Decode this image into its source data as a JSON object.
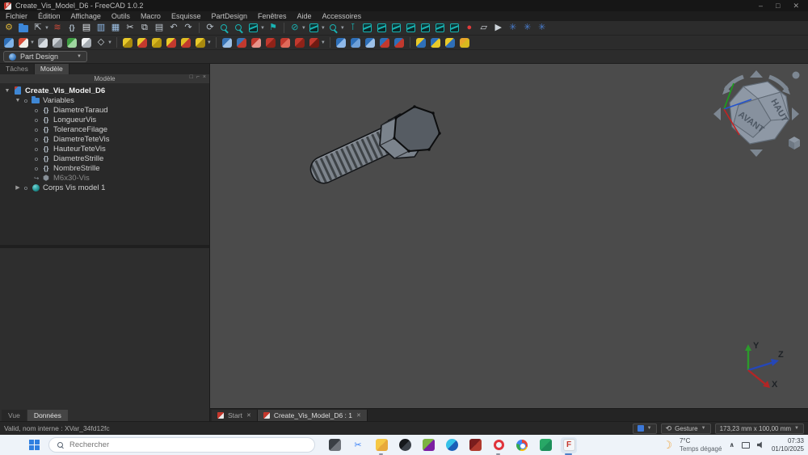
{
  "window": {
    "title": "Create_Vis_Model_D6 - FreeCAD 1.0.2",
    "minimize": "–",
    "maximize": "□",
    "close": "✕"
  },
  "menu": {
    "items": [
      "Fichier",
      "Édition",
      "Affichage",
      "Outils",
      "Macro",
      "Esquisse",
      "PartDesign",
      "Fenêtres",
      "Aide",
      "Accessoires"
    ]
  },
  "colors": {
    "accent_teal": "#19b3b3",
    "viewport_bg": "#4b4b4b",
    "taskbar_bg": "#eef3f9",
    "record_red": "#e23b3b"
  },
  "toolbar1": {
    "icons": [
      {
        "name": "freecad-start",
        "shape": "ch",
        "ch": "⚙",
        "c": "#d8b23a"
      },
      {
        "name": "open-folder",
        "shape": "fold",
        "c": "#3c86d8"
      },
      {
        "name": "export",
        "shape": "ch",
        "ch": "⇱",
        "c": "#c9d1d9",
        "dd": true
      },
      {
        "name": "appearance",
        "shape": "ch",
        "ch": "≋",
        "c": "#cf4a3a"
      },
      {
        "name": "expression",
        "shape": "ch",
        "ch": "{}",
        "c": "#aebecb",
        "small": true
      },
      {
        "name": "new-document",
        "shape": "ch",
        "ch": "▤",
        "c": "#e4e9ee"
      },
      {
        "name": "open-document",
        "shape": "ch",
        "ch": "▥",
        "c": "#8fb9e8"
      },
      {
        "name": "save",
        "shape": "ch",
        "ch": "▦",
        "c": "#9fc3e8"
      },
      {
        "name": "cut",
        "shape": "ch",
        "ch": "✂",
        "c": "#d2d9e0"
      },
      {
        "name": "copy",
        "shape": "ch",
        "ch": "⧉",
        "c": "#d2d9e0"
      },
      {
        "name": "paste",
        "shape": "ch",
        "ch": "▤",
        "c": "#bfc9d2"
      },
      {
        "name": "undo",
        "shape": "ch",
        "ch": "↶",
        "c": "#b6bfc8"
      },
      {
        "name": "redo",
        "shape": "ch",
        "ch": "↷",
        "c": "#b6bfc8"
      },
      {
        "sep": true
      },
      {
        "name": "refresh",
        "shape": "ch",
        "ch": "⟳",
        "c": "#b6bfc8"
      },
      {
        "name": "fit-all",
        "shape": "mag"
      },
      {
        "name": "fit-selection",
        "shape": "mag"
      },
      {
        "name": "view-isometric",
        "shape": "cube",
        "dd": true
      },
      {
        "name": "measure",
        "shape": "ch",
        "ch": "⚑",
        "c": "#19b3b3"
      },
      {
        "sep": true
      },
      {
        "name": "clipping",
        "shape": "ch",
        "ch": "⊘",
        "c": "#19b3b3",
        "dd": true
      },
      {
        "name": "axonometric",
        "shape": "cube",
        "dd": true
      },
      {
        "name": "zoom",
        "shape": "mag",
        "dd": true
      },
      {
        "name": "caliper",
        "shape": "ch",
        "ch": "⊺",
        "c": "#19b3b3"
      },
      {
        "name": "view-home",
        "shape": "cube"
      },
      {
        "name": "view-front",
        "shape": "cube"
      },
      {
        "name": "view-top",
        "shape": "cube"
      },
      {
        "name": "view-right",
        "shape": "cube"
      },
      {
        "name": "view-rear",
        "shape": "cube"
      },
      {
        "name": "view-bottom",
        "shape": "cube"
      },
      {
        "name": "view-left",
        "shape": "cube"
      },
      {
        "name": "macro-record",
        "shape": "ch",
        "ch": "●",
        "c": "#e23b3b"
      },
      {
        "name": "macro-edit",
        "shape": "ch",
        "ch": "▱",
        "c": "#d8dde2"
      },
      {
        "name": "macro-play",
        "shape": "ch",
        "ch": "▶",
        "c": "#cdd4da"
      },
      {
        "name": "debug-start",
        "shape": "ch",
        "ch": "✳",
        "c": "#4a7ed0"
      },
      {
        "name": "debug-stop",
        "shape": "ch",
        "ch": "✳",
        "c": "#4a7ed0"
      },
      {
        "name": "debug-step",
        "shape": "ch",
        "ch": "✳",
        "c": "#4a7ed0"
      }
    ]
  },
  "toolbar2": {
    "icons": [
      {
        "name": "create-body",
        "shape": "blob",
        "c1": "#2e6fb8",
        "c2": "#7fb2e8"
      },
      {
        "name": "create-sketch",
        "shape": "blob",
        "c1": "#d94f3a",
        "c2": "#f0efe8",
        "dd": true
      },
      {
        "name": "edit-sketch",
        "shape": "blob",
        "c1": "#8a9097",
        "c2": "#d7dce1"
      },
      {
        "name": "map-sketch",
        "shape": "blob",
        "c1": "#c9ced3",
        "c2": "#8d9399"
      },
      {
        "name": "clone",
        "shape": "blob",
        "c1": "#3f9d43",
        "c2": "#9fd6a0"
      },
      {
        "name": "shape-binder",
        "shape": "blob",
        "c1": "#eef0f2",
        "c2": "#a7adb3"
      },
      {
        "name": "datum",
        "shape": "ch",
        "ch": "◇",
        "c": "#ccd4db",
        "dd": true
      },
      {
        "sep": true
      },
      {
        "name": "pad",
        "shape": "blob",
        "c1": "#e8c92a",
        "c2": "#a8890e"
      },
      {
        "name": "revolution",
        "shape": "blob",
        "c1": "#e8c92a",
        "c2": "#c2392e"
      },
      {
        "name": "additive-loft",
        "shape": "blob",
        "c1": "#d8b81f",
        "c2": "#b5950f"
      },
      {
        "name": "additive-pipe",
        "shape": "blob",
        "c1": "#e8c92a",
        "c2": "#c2392e"
      },
      {
        "name": "additive-helix",
        "shape": "blob",
        "c1": "#e0bc22",
        "c2": "#c2392e"
      },
      {
        "name": "additive-primitive",
        "shape": "blob",
        "c1": "#e8c92a",
        "c2": "#a8890e",
        "dd": true
      },
      {
        "sep": true
      },
      {
        "name": "pocket",
        "shape": "blob",
        "c1": "#3a74b5",
        "c2": "#9dc1e8"
      },
      {
        "name": "hole",
        "shape": "blob",
        "c1": "#3a74b5",
        "c2": "#c2392e"
      },
      {
        "name": "groove",
        "shape": "blob",
        "c1": "#c2392e",
        "c2": "#e8938a"
      },
      {
        "name": "subtractive-loft",
        "shape": "blob",
        "c1": "#c2392e",
        "c2": "#8f2218"
      },
      {
        "name": "subtractive-pipe",
        "shape": "blob",
        "c1": "#c2392e",
        "c2": "#e06a5a"
      },
      {
        "name": "subtractive-helix",
        "shape": "blob",
        "c1": "#c2392e",
        "c2": "#8f2218"
      },
      {
        "name": "subtractive-primitive",
        "shape": "blob",
        "c1": "#c2392e",
        "c2": "#6f1a12",
        "dd": true
      },
      {
        "sep": true
      },
      {
        "name": "fillet",
        "shape": "blob",
        "c1": "#2e6fb8",
        "c2": "#8fb8e8"
      },
      {
        "name": "chamfer",
        "shape": "blob",
        "c1": "#2e6fb8",
        "c2": "#6fa0d8"
      },
      {
        "name": "draft",
        "shape": "blob",
        "c1": "#2e6fb8",
        "c2": "#9dc1e8"
      },
      {
        "name": "thickness",
        "shape": "blob",
        "c1": "#2e6fb8",
        "c2": "#c2392e"
      },
      {
        "name": "pattern",
        "shape": "blob",
        "c1": "#2e6fb8",
        "c2": "#c2392e"
      },
      {
        "sep": true
      },
      {
        "name": "boolean-union",
        "shape": "blob",
        "c1": "#e8c92a",
        "c2": "#2e6fb8"
      },
      {
        "name": "boolean-cut",
        "shape": "blob",
        "c1": "#2e6fb8",
        "c2": "#e8c92a"
      },
      {
        "name": "boolean-common",
        "shape": "blob",
        "c1": "#e8c92a",
        "c2": "#2e6fb8"
      },
      {
        "name": "boolean-compound",
        "shape": "blob",
        "c1": "#e8a52a",
        "c2": "#d8b81f"
      }
    ]
  },
  "workbench": {
    "selected": "Part Design"
  },
  "panel": {
    "tabs": [
      {
        "label": "Tâches",
        "active": false
      },
      {
        "label": "Modèle",
        "active": true
      }
    ],
    "header": "Modèle",
    "header_icons": [
      "float",
      "undock",
      "close"
    ]
  },
  "tree": {
    "items": [
      {
        "label": "Create_Vis_Model_D6",
        "lvl": 0,
        "arrow": "down",
        "icon": "doc",
        "bold": true
      },
      {
        "label": "Variables",
        "lvl": 1,
        "arrow": "down",
        "vis": true,
        "icon": "folder"
      },
      {
        "label": "DiametreTaraud",
        "lvl": 2,
        "vis": true,
        "icon": "var"
      },
      {
        "label": "LongueurVis",
        "lvl": 2,
        "vis": true,
        "icon": "var"
      },
      {
        "label": "ToleranceFilage",
        "lvl": 2,
        "vis": true,
        "icon": "var"
      },
      {
        "label": "DiametreTeteVis",
        "lvl": 2,
        "vis": true,
        "icon": "var"
      },
      {
        "label": "HauteurTeteVis",
        "lvl": 2,
        "vis": true,
        "icon": "var"
      },
      {
        "label": "DiametreStrille",
        "lvl": 2,
        "vis": true,
        "icon": "var"
      },
      {
        "label": "NombreStrille",
        "lvl": 2,
        "vis": true,
        "icon": "var"
      },
      {
        "label": "M6x30-Vis",
        "lvl": 2,
        "link": true,
        "icon": "screw",
        "gray": true
      },
      {
        "label": "Corps Vis model 1",
        "lvl": 1,
        "arrow": "right",
        "vis": true,
        "icon": "body"
      }
    ]
  },
  "bottom_tabs": [
    {
      "label": "Vue",
      "active": false
    },
    {
      "label": "Données",
      "active": true
    }
  ],
  "mdi": {
    "tabs": [
      {
        "label": "Start",
        "close": "✕",
        "active": false
      },
      {
        "label": "Create_Vis_Model_D6 : 1",
        "close": "✕",
        "active": true
      }
    ]
  },
  "viewport": {
    "navcube": {
      "top_label": "HAUT",
      "front_label": "AVANT"
    },
    "axes": {
      "x": "X",
      "y": "Y",
      "z": "Z"
    }
  },
  "statusbar": {
    "message": "Valid, nom interne : XVar_34fd12fc",
    "nav_style_label": "Gesture",
    "dimension_label": "173,23 mm x 100,00 mm"
  },
  "taskbar": {
    "search_placeholder": "Rechercher",
    "apps": [
      {
        "name": "task-view",
        "shape": "blob",
        "c1": "#3a3f45",
        "c2": "#70757c"
      },
      {
        "name": "snipping-tool",
        "shape": "ch",
        "ch": "✂",
        "c": "#3b82f6"
      },
      {
        "name": "file-explorer",
        "shape": "blob",
        "c1": "#f6c844",
        "c2": "#e8a93a",
        "run": true
      },
      {
        "name": "app-dark",
        "shape": "blob",
        "c1": "#15181c",
        "c2": "#3a4048",
        "round": true
      },
      {
        "name": "app-colorful",
        "shape": "blob",
        "c1": "#7cb342",
        "c2": "#7b1fa2"
      },
      {
        "name": "edge-browser",
        "shape": "blob",
        "c1": "#35c1e8",
        "c2": "#1b5fb8",
        "round": true
      },
      {
        "name": "brave-browser",
        "shape": "blob",
        "c1": "#7a1d1d",
        "c2": "#b03a2e"
      },
      {
        "name": "opera-browser",
        "shape": "ring",
        "run": true
      },
      {
        "name": "chrome-browser",
        "shape": "chrome"
      },
      {
        "name": "green-app",
        "shape": "blob",
        "c1": "#28a866",
        "c2": "#1d8f5a"
      },
      {
        "name": "freecad",
        "shape": "fc",
        "active": true
      }
    ],
    "tray": {
      "temperature": "7°C",
      "condition": "Temps dégagé",
      "time": "07:33",
      "date": "01/10/2025"
    }
  }
}
